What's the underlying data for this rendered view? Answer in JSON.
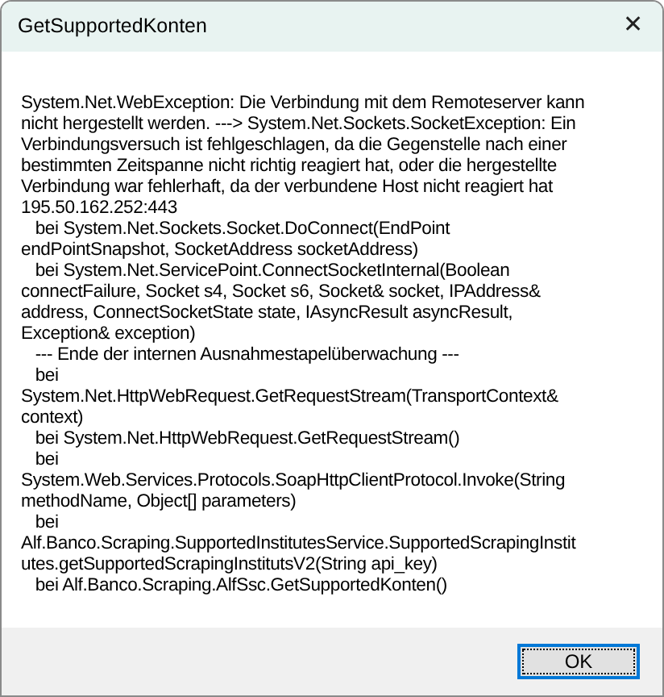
{
  "window": {
    "title": "GetSupportedKonten",
    "close_glyph": "✕"
  },
  "message_lines": [
    "System.Net.WebException: Die Verbindung mit dem Remoteserver kann",
    "nicht hergestellt werden. ---> System.Net.Sockets.SocketException: Ein",
    "Verbindungsversuch ist fehlgeschlagen, da die Gegenstelle nach einer",
    "bestimmten Zeitspanne nicht richtig reagiert hat, oder die hergestellte",
    "Verbindung war fehlerhaft, da der verbundene Host nicht reagiert hat",
    "195.50.162.252:443",
    "   bei System.Net.Sockets.Socket.DoConnect(EndPoint",
    "endPointSnapshot, SocketAddress socketAddress)",
    "   bei System.Net.ServicePoint.ConnectSocketInternal(Boolean",
    "connectFailure, Socket s4, Socket s6, Socket& socket, IPAddress&",
    "address, ConnectSocketState state, IAsyncResult asyncResult,",
    "Exception& exception)",
    "   --- Ende der internen Ausnahmestapelüberwachung ---",
    "   bei",
    "System.Net.HttpWebRequest.GetRequestStream(TransportContext&",
    "context)",
    "   bei System.Net.HttpWebRequest.GetRequestStream()",
    "   bei",
    "System.Web.Services.Protocols.SoapHttpClientProtocol.Invoke(String",
    "methodName, Object[] parameters)",
    "   bei",
    "Alf.Banco.Scraping.SupportedInstitutesService.SupportedScrapingInstit",
    "utes.getSupportedScrapingInstitutsV2(String api_key)",
    "   bei Alf.Banco.Scraping.AlfSsc.GetSupportedKonten()"
  ],
  "buttons": [
    {
      "label": "OK",
      "default": true
    }
  ]
}
